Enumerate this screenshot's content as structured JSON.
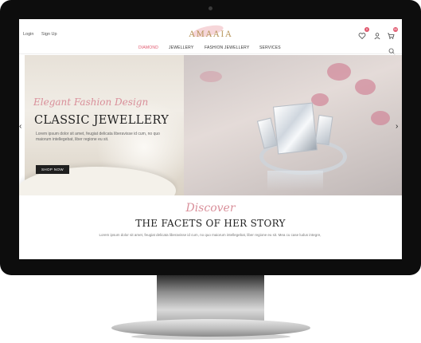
{
  "header": {
    "login": "Login",
    "signup": "Sign Up",
    "logo": "AMAAIA",
    "wishlist_count": "0",
    "cart_count": "00"
  },
  "nav": {
    "items": [
      {
        "label": "DIAMOND",
        "active": true
      },
      {
        "label": "JEWELLERY",
        "active": false
      },
      {
        "label": "FASHION JEWELLERY",
        "active": false
      },
      {
        "label": "SERVICES",
        "active": false
      }
    ]
  },
  "hero": {
    "script_title": "Elegant Fashion Design",
    "title": "CLASSIC JEWELLERY",
    "text": "Lorem ipsum dolor sit amet, feugiat delicata liberavisse id cum, no quo maiorum intellegebat, liber regione eu sit.",
    "button": "SHOP NOW",
    "prev": "‹",
    "next": "›"
  },
  "discover": {
    "script": "Discover",
    "title": "THE FACETS OF HER STORY",
    "text": "Lorem ipsum dolor sit amet, feugiat delicata liberavisse id cum, no quo maiorum intellegebat, liber regione eu sit. Mea cu case ludus integre,"
  },
  "colors": {
    "accent": "#e0566c",
    "script_pink": "#d98f9a",
    "logo_gold": "#b59257",
    "button_dark": "#1f1f1f"
  },
  "icons": {
    "wishlist": "heart-icon",
    "account": "user-icon",
    "cart": "cart-icon",
    "search": "search-icon",
    "prev": "chevron-left-icon",
    "next": "chevron-right-icon"
  }
}
